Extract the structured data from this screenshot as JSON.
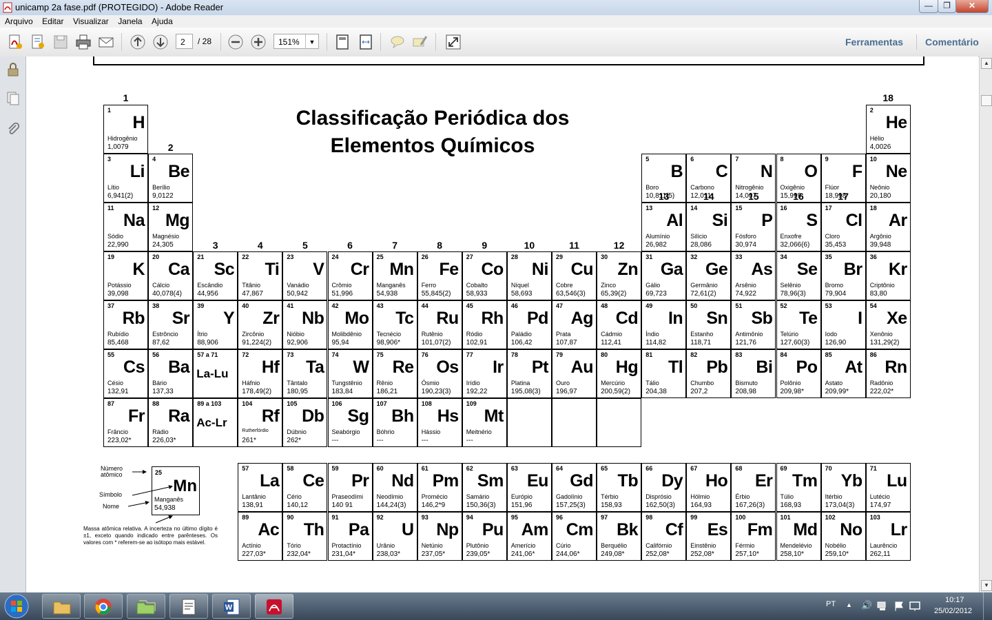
{
  "window": {
    "title": "unicamp 2a fase.pdf (PROTEGIDO) - Adobe Reader",
    "minimize": "—",
    "maximize": "❐",
    "close": "✕"
  },
  "menu": [
    "Arquivo",
    "Editar",
    "Visualizar",
    "Janela",
    "Ajuda"
  ],
  "toolbar": {
    "page_current": "2",
    "page_total": "/ 28",
    "zoom": "151%",
    "tools_label": "Ferramentas",
    "comment_label": "Comentário"
  },
  "taskbar": {
    "lang": "PT",
    "time": "10:17",
    "date": "25/02/2012"
  },
  "table": {
    "title_line1": "Classificação Periódica dos",
    "title_line2": "Elementos Químicos",
    "groups": [
      "1",
      "2",
      "3",
      "4",
      "5",
      "6",
      "7",
      "8",
      "9",
      "10",
      "11",
      "12",
      "13",
      "14",
      "15",
      "16",
      "17",
      "18"
    ],
    "elements": [
      {
        "n": "1",
        "s": "H",
        "name": "Hidrogênio",
        "mass": "1,0079"
      },
      {
        "n": "2",
        "s": "He",
        "name": "Hélio",
        "mass": "4,0026"
      },
      {
        "n": "3",
        "s": "Li",
        "name": "Lítio",
        "mass": "6,941(2)"
      },
      {
        "n": "4",
        "s": "Be",
        "name": "Berílio",
        "mass": "9,0122"
      },
      {
        "n": "5",
        "s": "B",
        "name": "Boro",
        "mass": "10,811(5)"
      },
      {
        "n": "6",
        "s": "C",
        "name": "Carbono",
        "mass": "12,011"
      },
      {
        "n": "7",
        "s": "N",
        "name": "Nitrogênio",
        "mass": "14,007"
      },
      {
        "n": "8",
        "s": "O",
        "name": "Oxigênio",
        "mass": "15,999"
      },
      {
        "n": "9",
        "s": "F",
        "name": "Flúor",
        "mass": "18,998"
      },
      {
        "n": "10",
        "s": "Ne",
        "name": "Neônio",
        "mass": "20,180"
      },
      {
        "n": "11",
        "s": "Na",
        "name": "Sódio",
        "mass": "22,990"
      },
      {
        "n": "12",
        "s": "Mg",
        "name": "Magnésio",
        "mass": "24,305"
      },
      {
        "n": "13",
        "s": "Al",
        "name": "Alumínio",
        "mass": "26,982"
      },
      {
        "n": "14",
        "s": "Si",
        "name": "Silício",
        "mass": "28,086"
      },
      {
        "n": "15",
        "s": "P",
        "name": "Fósforo",
        "mass": "30,974"
      },
      {
        "n": "16",
        "s": "S",
        "name": "Enxofre",
        "mass": "32,066(6)"
      },
      {
        "n": "17",
        "s": "Cl",
        "name": "Cloro",
        "mass": "35,453"
      },
      {
        "n": "18",
        "s": "Ar",
        "name": "Argônio",
        "mass": "39,948"
      },
      {
        "n": "19",
        "s": "K",
        "name": "Potássio",
        "mass": "39,098"
      },
      {
        "n": "20",
        "s": "Ca",
        "name": "Cálcio",
        "mass": "40,078(4)"
      },
      {
        "n": "21",
        "s": "Sc",
        "name": "Escândio",
        "mass": "44,956"
      },
      {
        "n": "22",
        "s": "Ti",
        "name": "Titânio",
        "mass": "47,867"
      },
      {
        "n": "23",
        "s": "V",
        "name": "Vanádio",
        "mass": "50,942"
      },
      {
        "n": "24",
        "s": "Cr",
        "name": "Crômio",
        "mass": "51,996"
      },
      {
        "n": "25",
        "s": "Mn",
        "name": "Manganês",
        "mass": "54,938"
      },
      {
        "n": "26",
        "s": "Fe",
        "name": "Ferro",
        "mass": "55,845(2)"
      },
      {
        "n": "27",
        "s": "Co",
        "name": "Cobalto",
        "mass": "58,933"
      },
      {
        "n": "28",
        "s": "Ni",
        "name": "Níquel",
        "mass": "58,693"
      },
      {
        "n": "29",
        "s": "Cu",
        "name": "Cobre",
        "mass": "63,546(3)"
      },
      {
        "n": "30",
        "s": "Zn",
        "name": "Zinco",
        "mass": "65,39(2)"
      },
      {
        "n": "31",
        "s": "Ga",
        "name": "Gálio",
        "mass": "69,723"
      },
      {
        "n": "32",
        "s": "Ge",
        "name": "Germânio",
        "mass": "72,61(2)"
      },
      {
        "n": "33",
        "s": "As",
        "name": "Arsênio",
        "mass": "74,922"
      },
      {
        "n": "34",
        "s": "Se",
        "name": "Selênio",
        "mass": "78,96(3)"
      },
      {
        "n": "35",
        "s": "Br",
        "name": "Bromo",
        "mass": "79,904"
      },
      {
        "n": "36",
        "s": "Kr",
        "name": "Criptônio",
        "mass": "83,80"
      },
      {
        "n": "37",
        "s": "Rb",
        "name": "Rubídio",
        "mass": "85,468"
      },
      {
        "n": "38",
        "s": "Sr",
        "name": "Estrôncio",
        "mass": "87,62"
      },
      {
        "n": "39",
        "s": "Y",
        "name": "Ítrio",
        "mass": "88,906"
      },
      {
        "n": "40",
        "s": "Zr",
        "name": "Zircônio",
        "mass": "91,224(2)"
      },
      {
        "n": "41",
        "s": "Nb",
        "name": "Nióbio",
        "mass": "92,906"
      },
      {
        "n": "42",
        "s": "Mo",
        "name": "Molibdênio",
        "mass": "95,94"
      },
      {
        "n": "43",
        "s": "Tc",
        "name": "Tecnécio",
        "mass": "98,906*"
      },
      {
        "n": "44",
        "s": "Ru",
        "name": "Rutênio",
        "mass": "101,07(2)"
      },
      {
        "n": "45",
        "s": "Rh",
        "name": "Ródio",
        "mass": "102,91"
      },
      {
        "n": "46",
        "s": "Pd",
        "name": "Paládio",
        "mass": "106,42"
      },
      {
        "n": "47",
        "s": "Ag",
        "name": "Prata",
        "mass": "107,87"
      },
      {
        "n": "48",
        "s": "Cd",
        "name": "Cádmio",
        "mass": "112,41"
      },
      {
        "n": "49",
        "s": "In",
        "name": "Índio",
        "mass": "114,82"
      },
      {
        "n": "50",
        "s": "Sn",
        "name": "Estanho",
        "mass": "118,71"
      },
      {
        "n": "51",
        "s": "Sb",
        "name": "Antimônio",
        "mass": "121,76"
      },
      {
        "n": "52",
        "s": "Te",
        "name": "Telúrio",
        "mass": "127,60(3)"
      },
      {
        "n": "53",
        "s": "I",
        "name": "Iodo",
        "mass": "126,90"
      },
      {
        "n": "54",
        "s": "Xe",
        "name": "Xenônio",
        "mass": "131,29(2)"
      },
      {
        "n": "55",
        "s": "Cs",
        "name": "Césio",
        "mass": "132,91"
      },
      {
        "n": "56",
        "s": "Ba",
        "name": "Bário",
        "mass": "137,33"
      },
      {
        "n": "57 a 71",
        "s": "La-Lu",
        "name": "",
        "mass": "",
        "series": true
      },
      {
        "n": "72",
        "s": "Hf",
        "name": "Háfnio",
        "mass": "178,49(2)"
      },
      {
        "n": "73",
        "s": "Ta",
        "name": "Tântalo",
        "mass": "180,95"
      },
      {
        "n": "74",
        "s": "W",
        "name": "Tungstênio",
        "mass": "183,84"
      },
      {
        "n": "75",
        "s": "Re",
        "name": "Rênio",
        "mass": "186,21"
      },
      {
        "n": "76",
        "s": "Os",
        "name": "Ósmio",
        "mass": "190,23(3)"
      },
      {
        "n": "77",
        "s": "Ir",
        "name": "Irídio",
        "mass": "192,22"
      },
      {
        "n": "78",
        "s": "Pt",
        "name": "Platina",
        "mass": "195,08(3)"
      },
      {
        "n": "79",
        "s": "Au",
        "name": "Ouro",
        "mass": "196,97"
      },
      {
        "n": "80",
        "s": "Hg",
        "name": "Mercúrio",
        "mass": "200,59(2)"
      },
      {
        "n": "81",
        "s": "Tl",
        "name": "Tálio",
        "mass": "204,38"
      },
      {
        "n": "82",
        "s": "Pb",
        "name": "Chumbo",
        "mass": "207,2"
      },
      {
        "n": "83",
        "s": "Bi",
        "name": "Bismuto",
        "mass": "208,98"
      },
      {
        "n": "84",
        "s": "Po",
        "name": "Polônio",
        "mass": "209,98*"
      },
      {
        "n": "85",
        "s": "At",
        "name": "Astato",
        "mass": "209,99*"
      },
      {
        "n": "86",
        "s": "Rn",
        "name": "Radônio",
        "mass": "222,02*"
      },
      {
        "n": "87",
        "s": "Fr",
        "name": "Frâncio",
        "mass": "223,02*"
      },
      {
        "n": "88",
        "s": "Ra",
        "name": "Rádio",
        "mass": "226,03*"
      },
      {
        "n": "89 a 103",
        "s": "Ac-Lr",
        "name": "",
        "mass": "",
        "series": true
      },
      {
        "n": "104",
        "s": "Rf",
        "name": "Rutherfórdio",
        "mass": "261*",
        "tiny": true
      },
      {
        "n": "105",
        "s": "Db",
        "name": "Dúbnio",
        "mass": "262*"
      },
      {
        "n": "106",
        "s": "Sg",
        "name": "Seabórgio",
        "mass": "---"
      },
      {
        "n": "107",
        "s": "Bh",
        "name": "Bóhrio",
        "mass": "---"
      },
      {
        "n": "108",
        "s": "Hs",
        "name": "Hássio",
        "mass": "---"
      },
      {
        "n": "109",
        "s": "Mt",
        "name": "Meitnério",
        "mass": "---"
      },
      {
        "n": "",
        "s": "",
        "name": "",
        "mass": "",
        "empty": true
      },
      {
        "n": "",
        "s": "",
        "name": "",
        "mass": "",
        "empty": true
      },
      {
        "n": "",
        "s": "",
        "name": "",
        "mass": "",
        "empty": true
      },
      {
        "n": "57",
        "s": "La",
        "name": "Lantânio",
        "mass": "138,91"
      },
      {
        "n": "58",
        "s": "Ce",
        "name": "Cério",
        "mass": "140,12"
      },
      {
        "n": "59",
        "s": "Pr",
        "name": "Praseodími",
        "mass": "140 91"
      },
      {
        "n": "60",
        "s": "Nd",
        "name": "Neodímio",
        "mass": "144,24(3)"
      },
      {
        "n": "61",
        "s": "Pm",
        "name": "Promécio",
        "mass": "146,2*9"
      },
      {
        "n": "62",
        "s": "Sm",
        "name": "Samário",
        "mass": "150,36(3)"
      },
      {
        "n": "63",
        "s": "Eu",
        "name": "Európio",
        "mass": "151,96"
      },
      {
        "n": "64",
        "s": "Gd",
        "name": "Gadolínio",
        "mass": "157,25(3)"
      },
      {
        "n": "65",
        "s": "Tb",
        "name": "Térbio",
        "mass": "158,93"
      },
      {
        "n": "66",
        "s": "Dy",
        "name": "Disprósio",
        "mass": "162,50(3)"
      },
      {
        "n": "67",
        "s": "Ho",
        "name": "Hólmio",
        "mass": "164,93"
      },
      {
        "n": "68",
        "s": "Er",
        "name": "Érbio",
        "mass": "167,26(3)"
      },
      {
        "n": "69",
        "s": "Tm",
        "name": "Túlio",
        "mass": "168,93"
      },
      {
        "n": "70",
        "s": "Yb",
        "name": "Itérbio",
        "mass": "173,04(3)"
      },
      {
        "n": "71",
        "s": "Lu",
        "name": "Lutécio",
        "mass": "174,97"
      },
      {
        "n": "89",
        "s": "Ac",
        "name": "Actínio",
        "mass": "227,03*"
      },
      {
        "n": "90",
        "s": "Th",
        "name": "Tório",
        "mass": "232,04*"
      },
      {
        "n": "91",
        "s": "Pa",
        "name": "Protactínio",
        "mass": "231,04*"
      },
      {
        "n": "92",
        "s": "U",
        "name": "Urânio",
        "mass": "238,03*"
      },
      {
        "n": "93",
        "s": "Np",
        "name": "Netúnio",
        "mass": "237,05*"
      },
      {
        "n": "94",
        "s": "Pu",
        "name": "Plutônio",
        "mass": "239,05*"
      },
      {
        "n": "95",
        "s": "Am",
        "name": "Amerício",
        "mass": "241,06*"
      },
      {
        "n": "96",
        "s": "Cm",
        "name": "Cúrio",
        "mass": "244,06*"
      },
      {
        "n": "97",
        "s": "Bk",
        "name": "Berquélio",
        "mass": "249,08*"
      },
      {
        "n": "98",
        "s": "Cf",
        "name": "Califórnio",
        "mass": "252,08*"
      },
      {
        "n": "99",
        "s": "Es",
        "name": "Einstênio",
        "mass": "252,08*"
      },
      {
        "n": "100",
        "s": "Fm",
        "name": "Férmio",
        "mass": "257,10*"
      },
      {
        "n": "101",
        "s": "Md",
        "name": "Mendelévio",
        "mass": "258,10*"
      },
      {
        "n": "102",
        "s": "No",
        "name": "Nobélio",
        "mass": "259,10*"
      },
      {
        "n": "103",
        "s": "Lr",
        "name": "Laurêncio",
        "mass": "262,11"
      }
    ],
    "legend": {
      "numero": "Número",
      "atomico": "atômico",
      "simbolo": "Símbolo",
      "nome": "Nome",
      "ex_n": "25",
      "ex_s": "Mn",
      "ex_name": "Manganês",
      "ex_mass": "54,938",
      "note": "Massa atômica relativa. A incerteza no último dígito é ±1, exceto quando indicado entre parênteses. Os valores com * referem-se ao isótopo mais estável."
    }
  }
}
